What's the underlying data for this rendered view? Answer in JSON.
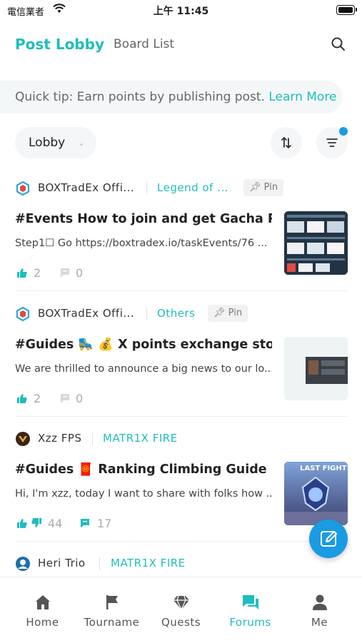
{
  "status_bar": {
    "carrier": "電信業者",
    "time": "上午 11:45"
  },
  "header": {
    "active_tab": "Post Lobby",
    "inactive_tab": "Board List"
  },
  "tip": {
    "text": "Quick tip: Earn points by publishing post. ",
    "link": "Learn More"
  },
  "filter": {
    "selected": "Lobby"
  },
  "posts": [
    {
      "author": "BOXTradEx Offi...",
      "board": "Legend of ...",
      "pin": "Pin",
      "title": "#Events How to join and get Gacha Poi...",
      "excerpt": "Step1☐  Go https://boxtradex.io/taskEvents/76 ...",
      "likes": "2",
      "comments": "0"
    },
    {
      "author": "BOXTradEx Offi...",
      "board": "Others",
      "pin": "Pin",
      "title": "#Guides 🛼 💰 X points exchange store ...",
      "excerpt": "We are thrilled to announce a big news to our lo...",
      "likes": "2",
      "comments": "0"
    },
    {
      "author": "Xzz FPS",
      "board": "MATR1X FIRE",
      "title": "#Guides 🧧 Ranking Climbing Guide",
      "excerpt": "Hi, I'm xzz, today I want to share with folks how ...",
      "likes": "44",
      "comments": "17",
      "thumb_text": "LAST FIGHT"
    },
    {
      "author": "Heri Trio",
      "board": "MATR1X FIRE"
    }
  ],
  "nav": [
    {
      "label": "Home",
      "icon": "home-icon"
    },
    {
      "label": "Tourname",
      "icon": "flag-icon"
    },
    {
      "label": "Quests",
      "icon": "diamond-icon"
    },
    {
      "label": "Forums",
      "icon": "forum-icon"
    },
    {
      "label": "Me",
      "icon": "person-icon"
    }
  ],
  "colors": {
    "accent": "#1fbdbb",
    "blue": "#1a9be2"
  }
}
